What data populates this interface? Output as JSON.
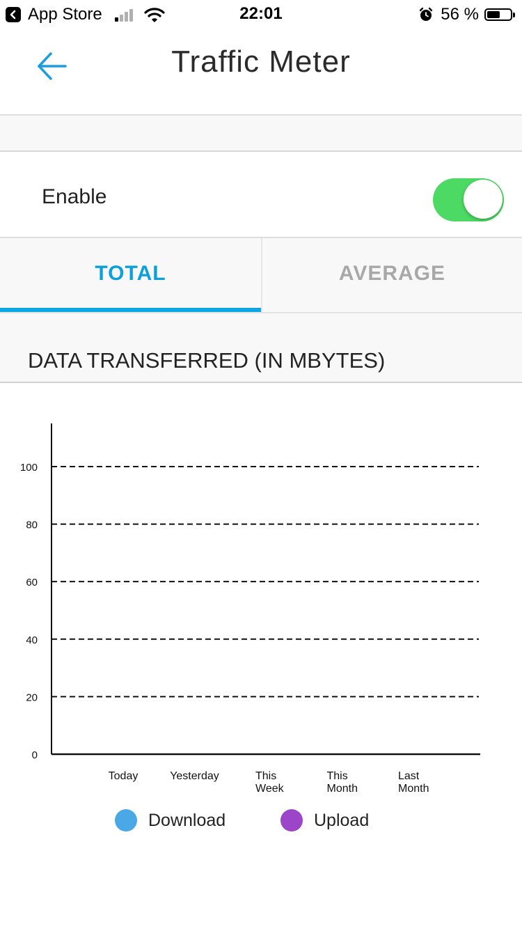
{
  "status_bar": {
    "back_app": "App Store",
    "time": "22:01",
    "battery_percent": "56 %",
    "battery_level": 0.56,
    "signal_bars_active": 1,
    "signal_bars_total": 4
  },
  "nav": {
    "title": "Traffic Meter",
    "back_icon": "arrow-left-icon",
    "accent_color": "#1a9ee0"
  },
  "enable": {
    "label": "Enable",
    "on": true,
    "toggle_color": "#4cd964"
  },
  "tabs": [
    {
      "label": "TOTAL",
      "active": true
    },
    {
      "label": "AVERAGE",
      "active": false
    }
  ],
  "section": {
    "title": "DATA TRANSFERRED (IN MBYTES)"
  },
  "chart_data": {
    "type": "bar",
    "title": "",
    "xlabel": "",
    "ylabel": "",
    "categories": [
      [
        "Today"
      ],
      [
        "Yesterday"
      ],
      [
        "This",
        "Week"
      ],
      [
        "This",
        "Month"
      ],
      [
        "Last",
        "Month"
      ]
    ],
    "series": [
      {
        "name": "Download",
        "color": "#4aa8e6",
        "values": [
          0,
          0,
          0,
          0,
          0
        ]
      },
      {
        "name": "Upload",
        "color": "#9d45c8",
        "values": [
          0,
          0,
          0,
          0,
          0
        ]
      }
    ],
    "yticks": [
      "0",
      "20",
      "40",
      "60",
      "80",
      "100"
    ],
    "ylim": [
      0,
      115
    ],
    "grid": "dashed horizontal",
    "legend_position": "bottom"
  }
}
